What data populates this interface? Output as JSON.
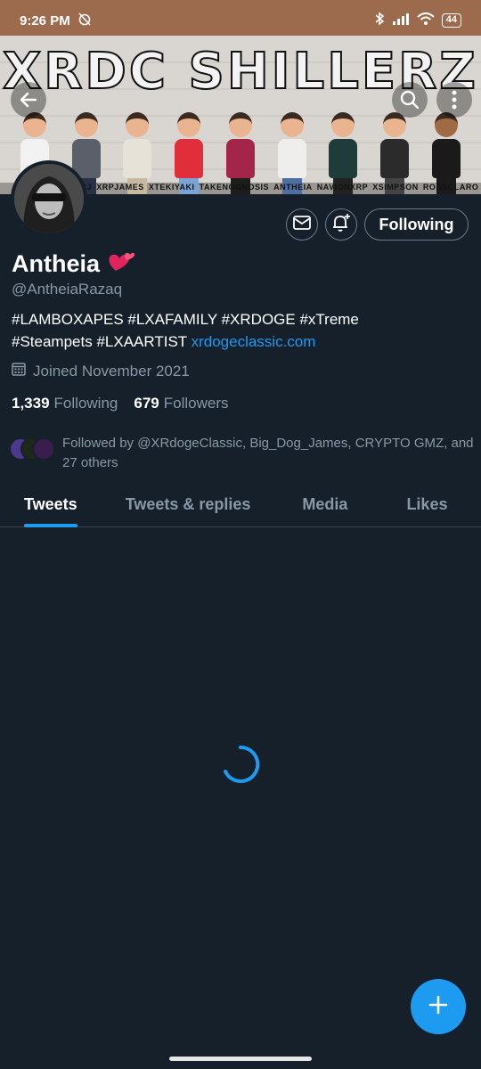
{
  "status_bar": {
    "time": "9:26 PM",
    "battery": "44"
  },
  "banner": {
    "title": "XRDC SHILLERZ",
    "names": [
      "COLOCJ",
      "XRPJAMES",
      "XTEKIYAKI",
      "TAKENOGNOSIS",
      "ANTHEIA",
      "NAVIONXRP",
      "XSIMPSON",
      "RODSCLARO"
    ]
  },
  "profile": {
    "name": "Antheia",
    "handle": "@AntheiaRazaq",
    "bio_line1": "#LAMBOXAPES #LXAFAMILY  #XRDOGE #xTreme",
    "bio_line2": "#Steampets #LXAARTIST ",
    "bio_link": "xrdogeclassic.com",
    "joined": "Joined November 2021",
    "following_count": "1,339",
    "following_label": "Following",
    "followers_count": "679",
    "followers_label": "Followers",
    "followed_by": "Followed by @XRdogeClassic, Big_Dog_James, CRYPTO GMZ, and 27 others"
  },
  "actions": {
    "following_button": "Following"
  },
  "tabs": [
    {
      "label": "Tweets",
      "active": true
    },
    {
      "label": "Tweets & replies",
      "active": false
    },
    {
      "label": "Media",
      "active": false
    },
    {
      "label": "Likes",
      "active": false
    }
  ],
  "colors": {
    "background": "#15202b",
    "accent": "#1d9bf0",
    "secondary_text": "#8899a6"
  }
}
